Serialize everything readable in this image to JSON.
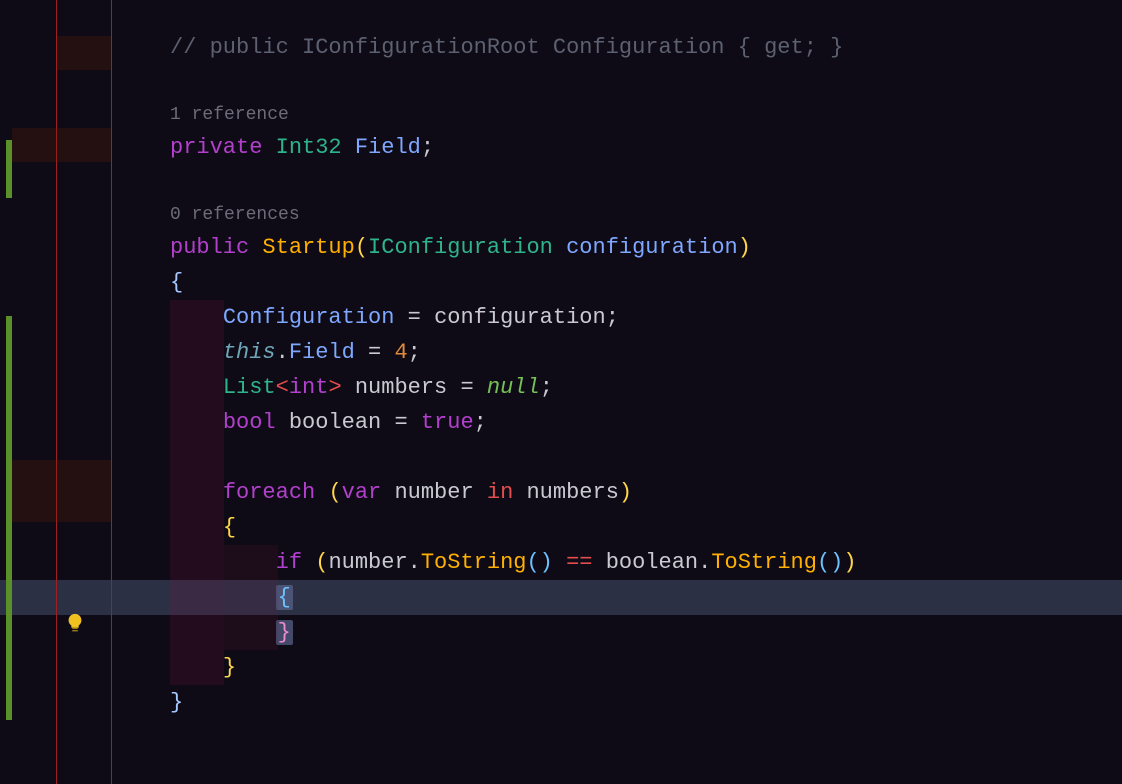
{
  "comment": "// public IConfigurationRoot Configuration { get; }",
  "codelens1": "1 reference",
  "codelens2": "0 references",
  "l2": {
    "kw": "private",
    "type": "Int32",
    "name": "Field",
    "semi": ";"
  },
  "l4": {
    "kw": "public",
    "cls": "Startup",
    "p1": "(",
    "ptype": "IConfiguration",
    "pname": "configuration",
    "p2": ")"
  },
  "braceOpen": "{",
  "braceClose": "}",
  "l6": {
    "lhs": "Configuration",
    "eq": " = ",
    "rhs": "configuration",
    "semi": ";"
  },
  "l7": {
    "this": "this",
    "dot": ".",
    "field": "Field",
    "eq": " = ",
    "val": "4",
    "semi": ";"
  },
  "l8": {
    "list": "List",
    "lt": "<",
    "int": "int",
    "gt": ">",
    "var": "numbers",
    "eq": " = ",
    "null": "null",
    "semi": ";"
  },
  "l9": {
    "bool": "bool",
    "var": "boolean",
    "eq": " = ",
    "true": "true",
    "semi": ";"
  },
  "l11": {
    "kw": "foreach",
    "p1": "(",
    "var": "var",
    "name": "number",
    "in": "in",
    "coll": "numbers",
    "p2": ")"
  },
  "l13": {
    "kw": "if",
    "p1": "(",
    "a": "number",
    "dot": ".",
    "fn": "ToString",
    "p2": "()",
    "eq": " == ",
    "b": "boolean",
    "fn2": "ToString",
    "p3": "()",
    "pc": ")"
  }
}
